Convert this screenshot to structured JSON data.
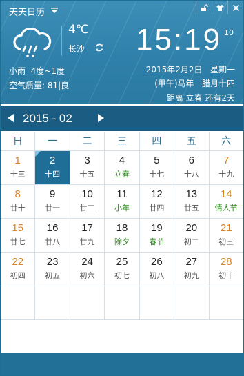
{
  "app": {
    "title": "天天日历"
  },
  "weather": {
    "temperature": "4℃",
    "city": "长沙",
    "condition": "小雨  4度~1度",
    "air_quality": "空气质量: 81|良"
  },
  "clock": {
    "time": "15:19",
    "seconds": "10"
  },
  "date_info": {
    "line1": "2015年2月2日   星期一",
    "line2": "(甲午)马年   腊月十四",
    "line3": "距离 立春 还有2天"
  },
  "calendar": {
    "month_label": "2015 - 02",
    "weekdays": [
      "日",
      "一",
      "二",
      "三",
      "四",
      "五",
      "六"
    ],
    "weeks": [
      [
        {
          "day": "1",
          "lunar": "十三",
          "we": true
        },
        {
          "day": "2",
          "lunar": "十四",
          "sel": true
        },
        {
          "day": "3",
          "lunar": "十五"
        },
        {
          "day": "4",
          "lunar": "立春",
          "fest": true
        },
        {
          "day": "5",
          "lunar": "十七"
        },
        {
          "day": "6",
          "lunar": "十八"
        },
        {
          "day": "7",
          "lunar": "十九",
          "we": true
        }
      ],
      [
        {
          "day": "8",
          "lunar": "廿十",
          "we": true
        },
        {
          "day": "9",
          "lunar": "廿一"
        },
        {
          "day": "10",
          "lunar": "廿二"
        },
        {
          "day": "11",
          "lunar": "小年",
          "fest": true
        },
        {
          "day": "12",
          "lunar": "廿四"
        },
        {
          "day": "13",
          "lunar": "廿五"
        },
        {
          "day": "14",
          "lunar": "情人节",
          "we": true,
          "fest": true
        }
      ],
      [
        {
          "day": "15",
          "lunar": "廿七",
          "we": true
        },
        {
          "day": "16",
          "lunar": "廿八"
        },
        {
          "day": "17",
          "lunar": "廿九"
        },
        {
          "day": "18",
          "lunar": "除夕",
          "fest": true
        },
        {
          "day": "19",
          "lunar": "春节",
          "fest": true
        },
        {
          "day": "20",
          "lunar": "初二"
        },
        {
          "day": "21",
          "lunar": "初三",
          "we": true
        }
      ],
      [
        {
          "day": "22",
          "lunar": "初四",
          "we": true
        },
        {
          "day": "23",
          "lunar": "初五"
        },
        {
          "day": "24",
          "lunar": "初六"
        },
        {
          "day": "25",
          "lunar": "初七"
        },
        {
          "day": "26",
          "lunar": "初八"
        },
        {
          "day": "27",
          "lunar": "初九"
        },
        {
          "day": "28",
          "lunar": "初十",
          "we": true
        }
      ],
      [
        {},
        {},
        {},
        {},
        {},
        {},
        {}
      ]
    ]
  },
  "icons": {
    "menu": "chevron-down-icon",
    "skin": "shirt-icon",
    "lock": "unlock-icon",
    "close": "close-icon",
    "weather": "rain-cloud-icon",
    "refresh": "refresh-icon",
    "prev": "arrow-left-icon",
    "next": "arrow-right-icon"
  },
  "colors": {
    "header": "#2f80aa",
    "nav": "#1b5d82",
    "selected": "#1f6e98",
    "weekend": "#d98326",
    "festival": "#2e8a1e"
  }
}
